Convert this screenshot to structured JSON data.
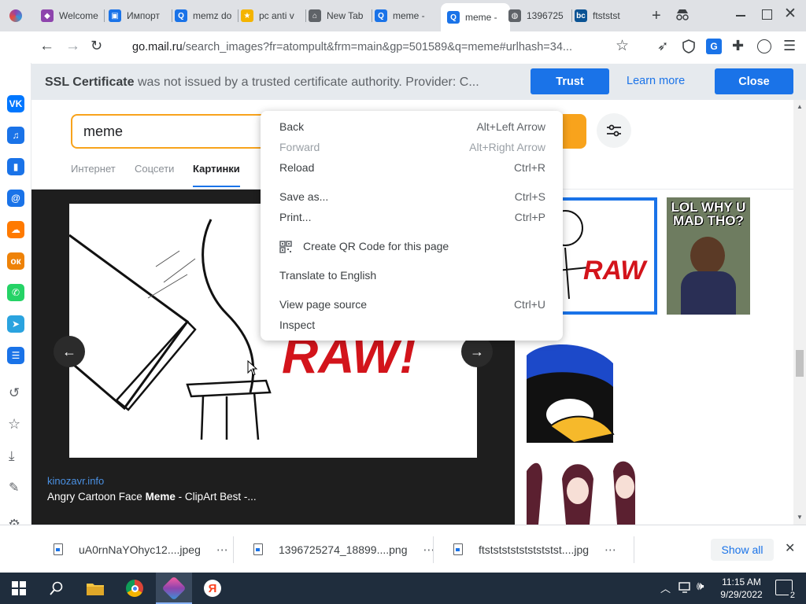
{
  "tabs": [
    {
      "label": "Welcome",
      "icon": "app-icon",
      "color": "#8e44ad"
    },
    {
      "label": "Импорт",
      "icon": "import-icon",
      "color": "#1a73e8"
    },
    {
      "label": "memz do",
      "icon": "search-icon",
      "color": "#1a73e8"
    },
    {
      "label": "pc anti v",
      "icon": "star-icon",
      "color": "#f4b400"
    },
    {
      "label": "New Tab",
      "icon": "incognito-icon",
      "color": "#5f6368"
    },
    {
      "label": "meme -",
      "icon": "search-icon",
      "color": "#1a73e8"
    },
    {
      "label": "meme -",
      "icon": "search-icon",
      "color": "#1a73e8",
      "active": true
    },
    {
      "label": "1396725",
      "icon": "globe-icon",
      "color": "#5f6368"
    },
    {
      "label": "ftststst",
      "icon": "bc-icon",
      "color": "#0b5394"
    }
  ],
  "address": {
    "host": "go.mail.ru",
    "path": "/search_images?fr=atompult&frm=main&gp=501589&q=meme#urlhash=34..."
  },
  "ssl": {
    "title": "SSL Certificate",
    "message": "was not issued by a trusted certificate authority. Provider: C...",
    "trust_label": "Trust",
    "learn_more_label": "Learn more",
    "close_label": "Close"
  },
  "search": {
    "query": "meme",
    "tabs": [
      "Интернет",
      "Соцсети",
      "Картинки"
    ]
  },
  "viewer": {
    "source": "kinozavr.info",
    "caption_pre": "Angry Cartoon Face ",
    "caption_bold": "Meme",
    "caption_post": " - ClipArt Best -...",
    "raw_text": "RAW!",
    "thumb_text": "LOL WHY U MAD THO?"
  },
  "context_menu": [
    {
      "label": "Back",
      "shortcut": "Alt+Left Arrow",
      "disabled": false
    },
    {
      "label": "Forward",
      "shortcut": "Alt+Right Arrow",
      "disabled": true
    },
    {
      "label": "Reload",
      "shortcut": "Ctrl+R",
      "disabled": false
    },
    {
      "label": "Save as...",
      "shortcut": "Ctrl+S",
      "disabled": false
    },
    {
      "label": "Print...",
      "shortcut": "Ctrl+P",
      "disabled": false
    },
    {
      "label": "Create QR Code for this page",
      "shortcut": "",
      "disabled": false,
      "icon": "qr-code-icon"
    },
    {
      "label": "Translate to English",
      "shortcut": "",
      "disabled": false
    },
    {
      "label": "View page source",
      "shortcut": "Ctrl+U",
      "disabled": false
    },
    {
      "label": "Inspect",
      "shortcut": "",
      "disabled": false
    }
  ],
  "downloads": {
    "items": [
      "uA0rnNaYOhyc12....jpeg",
      "1396725274_18899....png",
      "ftststststststststst....jpg"
    ],
    "show_all_label": "Show all"
  },
  "clock": {
    "time": "11:15 AM",
    "date": "9/29/2022"
  },
  "notifications": "2",
  "sidebar_icons": [
    {
      "name": "vk-icon",
      "color": "#0077ff",
      "glyph": "VK"
    },
    {
      "name": "music-icon",
      "color": "#1a73e8",
      "glyph": "♫"
    },
    {
      "name": "stats-icon",
      "color": "#1a73e8",
      "glyph": "▮"
    },
    {
      "name": "mail-icon",
      "color": "#1a73e8",
      "glyph": "@"
    },
    {
      "name": "cloud-icon",
      "color": "#ff7a00",
      "glyph": "☁"
    },
    {
      "name": "ok-icon",
      "color": "#ee8208",
      "glyph": "ок"
    },
    {
      "name": "whatsapp-icon",
      "color": "#25d366",
      "glyph": "✆"
    },
    {
      "name": "telegram-icon",
      "color": "#2aa3df",
      "glyph": "➤"
    },
    {
      "name": "list-icon",
      "color": "#1a73e8",
      "glyph": "☰"
    }
  ]
}
